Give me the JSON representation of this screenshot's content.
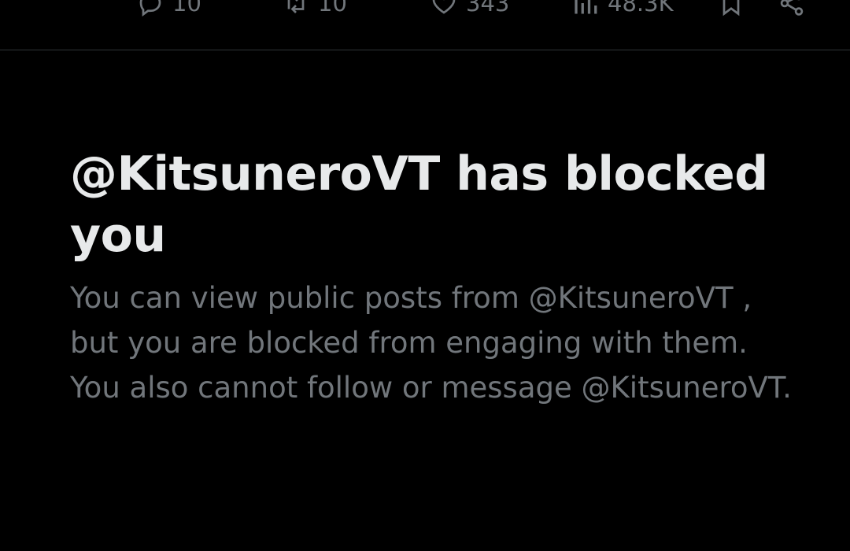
{
  "actions": {
    "reply": {
      "icon": "reply-icon",
      "count": "10"
    },
    "repost": {
      "icon": "repost-icon",
      "count": "10"
    },
    "like": {
      "icon": "heart-icon",
      "count": "343"
    },
    "views": {
      "icon": "views-chart-icon",
      "count": "48.3K"
    },
    "bookmark": {
      "icon": "bookmark-icon"
    },
    "share": {
      "icon": "share-icon"
    }
  },
  "blocked": {
    "title": "@KitsuneroVT has blocked you",
    "message": "You can view public posts from @KitsuneroVT , but you are blocked from engaging with them. You also cannot follow or message @KitsuneroVT."
  },
  "colors": {
    "background": "#000000",
    "primary_text": "#e7e9ea",
    "secondary_text": "#71767b",
    "divider": "#2f3336"
  }
}
